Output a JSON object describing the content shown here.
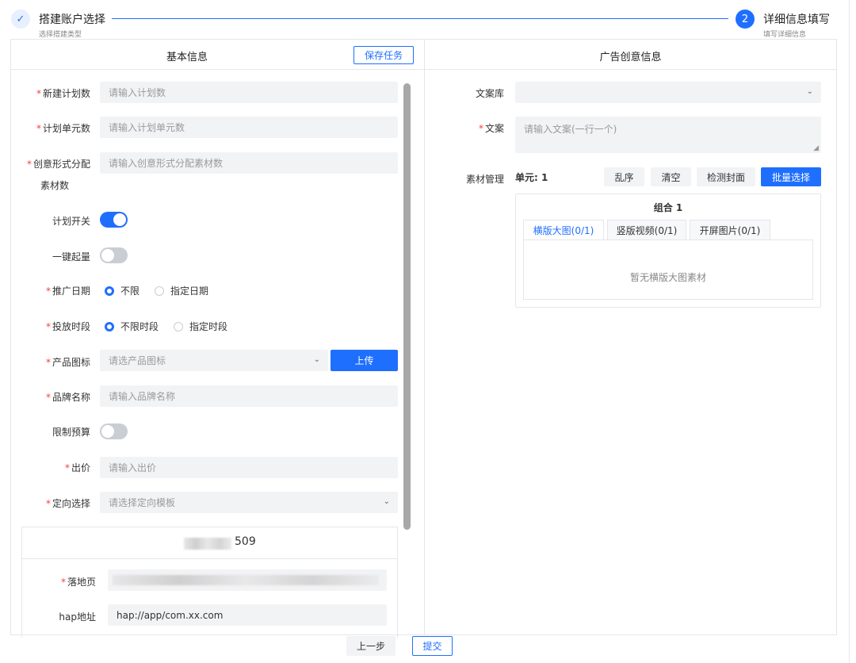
{
  "steps": {
    "step1": {
      "icon": "check-icon",
      "title": "搭建账户选择",
      "subtitle": "选择搭建类型"
    },
    "step2": {
      "number": "2",
      "title": "详细信息填写",
      "subtitle": "填写详细信息"
    }
  },
  "left_panel": {
    "title": "基本信息",
    "save_label": "保存任务",
    "fields": {
      "plan_count": {
        "label": "新建计划数",
        "placeholder": "请输入计划数"
      },
      "unit_count": {
        "label": "计划单元数",
        "placeholder": "请输入计划单元数"
      },
      "creative_alloc": {
        "label_line1": "创意形式分配",
        "label_line2": "素材数",
        "placeholder": "请输入创意形式分配素材数"
      },
      "plan_switch": {
        "label": "计划开关",
        "state": "on"
      },
      "one_click": {
        "label": "一键起量",
        "state": "off"
      },
      "promo_date": {
        "label": "推广日期",
        "options": [
          "不限",
          "指定日期"
        ],
        "selected": "不限"
      },
      "delivery_time": {
        "label": "投放时段",
        "options": [
          "不限时段",
          "指定时段"
        ],
        "selected": "不限时段"
      },
      "product_icon": {
        "label": "产品图标",
        "placeholder": "请选产品图标",
        "upload_label": "上传"
      },
      "brand_name": {
        "label": "品牌名称",
        "placeholder": "请输入品牌名称"
      },
      "budget_limit": {
        "label": "限制预算",
        "state": "off"
      },
      "bid": {
        "label": "出价",
        "placeholder": "请输入出价"
      },
      "targeting": {
        "label": "定向选择",
        "placeholder": "请选择定向模板"
      }
    },
    "sub_card": {
      "title_suffix": "509",
      "landing_label": "落地页",
      "hap_label": "hap地址",
      "hap_value": "hap://app/com.xx.com"
    }
  },
  "right_panel": {
    "title": "广告创意信息",
    "copy_library_label": "文案库",
    "copy_label": "文案",
    "copy_placeholder": "请输入文案(一行一个)",
    "material_label": "素材管理",
    "unit_text": "单元: 1",
    "buttons": {
      "shuffle": "乱序",
      "clear": "清空",
      "check_cover": "检测封面",
      "batch_select": "批量选择"
    },
    "combo": {
      "title": "组合 1",
      "tabs": [
        "横版大图(0/1)",
        "竖版视频(0/1)",
        "开屏图片(0/1)"
      ],
      "active_tab": 0,
      "empty_text": "暂无横版大图素材"
    }
  },
  "footer": {
    "prev_label": "上一步",
    "submit_label": "提交"
  },
  "colors": {
    "primary": "#1f6fff",
    "required": "#f53f3f",
    "input_bg": "#f2f3f5",
    "border": "#e5e6eb"
  }
}
